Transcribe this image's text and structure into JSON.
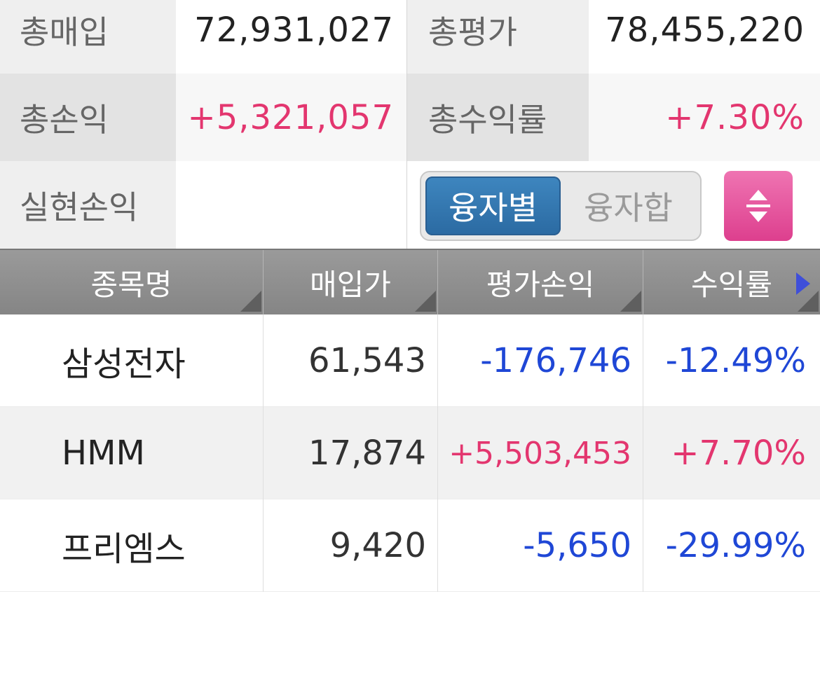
{
  "summary": {
    "total_purchase_label": "총매입",
    "total_purchase_value": "72,931,027",
    "total_eval_label": "총평가",
    "total_eval_value": "78,455,220",
    "total_pnl_label": "총손익",
    "total_pnl_value": "+5,321,057",
    "total_return_label": "총수익률",
    "total_return_value": "+7.30%",
    "realized_pnl_label": "실현손익",
    "realized_pnl_value": ""
  },
  "toggle": {
    "option_by_loan": "융자별",
    "option_loan_sum": "융자합",
    "selected": "융자별"
  },
  "table": {
    "headers": [
      "종목명",
      "매입가",
      "평가손익",
      "수익률"
    ],
    "rows": [
      {
        "name": "삼성전자",
        "purchase_price": "61,543",
        "eval_pnl": "-176,746",
        "return_rate": "-12.49%"
      },
      {
        "name": "HMM",
        "purchase_price": "17,874",
        "eval_pnl": "+5,503,453",
        "return_rate": "+7.70%"
      },
      {
        "name": "프리엠스",
        "purchase_price": "9,420",
        "eval_pnl": "-5,650",
        "return_rate": "-29.99%"
      }
    ]
  },
  "colors": {
    "positive": "#e3366f",
    "negative": "#1f47d6",
    "toggle_active": "#2b6aa2",
    "sort_button": "#dd3f8e"
  },
  "icons": {
    "sort_toggle": "sort-up-down-icon",
    "header_sort": "sort-corner-icon",
    "scroll_right": "chevron-right-icon"
  }
}
